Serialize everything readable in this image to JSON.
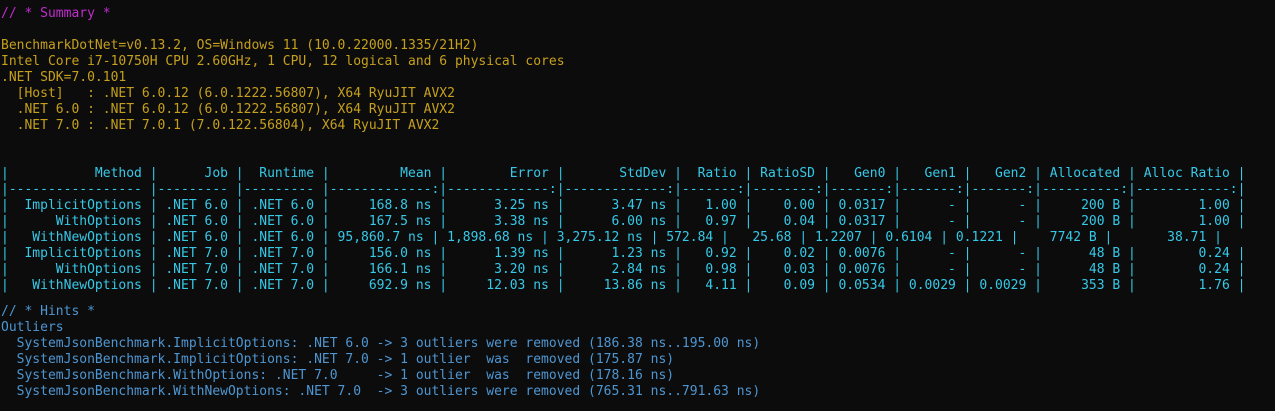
{
  "colors": {
    "background": "#0c0c0c",
    "summary_header": "#c22ccf",
    "env_info": "#c6a01d",
    "table": "#36c9e8",
    "hints": "#4e96d2"
  },
  "summary": {
    "header": "// * Summary *"
  },
  "environment": {
    "lines": [
      "BenchmarkDotNet=v0.13.2, OS=Windows 11 (10.0.22000.1335/21H2)",
      "Intel Core i7-10750H CPU 2.60GHz, 1 CPU, 12 logical and 6 physical cores",
      ".NET SDK=7.0.101",
      "  [Host]   : .NET 6.0.12 (6.0.1222.56807), X64 RyuJIT AVX2",
      "  .NET 6.0 : .NET 6.0.12 (6.0.1222.56807), X64 RyuJIT AVX2",
      "  .NET 7.0 : .NET 7.0.1 (7.0.122.56804), X64 RyuJIT AVX2"
    ]
  },
  "results_table": {
    "header": "|           Method |      Job |  Runtime |         Mean |        Error |       StdDev |  Ratio | RatioSD |   Gen0 |   Gen1 |   Gen2 | Allocated | Alloc Ratio |",
    "separator": "|----------------- |--------- |--------- |-------------:|-------------:|-------------:|-------:|--------:|-------:|-------:|-------:|----------:|------------:|",
    "rows": [
      "|  ImplicitOptions | .NET 6.0 | .NET 6.0 |     168.8 ns |      3.25 ns |      3.47 ns |   1.00 |    0.00 | 0.0317 |      - |      - |     200 B |        1.00 |",
      "|      WithOptions | .NET 6.0 | .NET 6.0 |     167.5 ns |      3.38 ns |      6.00 ns |   0.97 |    0.04 | 0.0317 |      - |      - |     200 B |        1.00 |",
      "|   WithNewOptions | .NET 6.0 | .NET 6.0 | 95,860.7 ns | 1,898.68 ns | 3,275.12 ns | 572.84 |   25.68 | 1.2207 | 0.6104 | 0.1221 |    7742 B |       38.71 |",
      "|  ImplicitOptions | .NET 7.0 | .NET 7.0 |     156.0 ns |      1.39 ns |      1.23 ns |   0.92 |    0.02 | 0.0076 |      - |      - |      48 B |        0.24 |",
      "|      WithOptions | .NET 7.0 | .NET 7.0 |     166.1 ns |      3.20 ns |      2.84 ns |   0.98 |    0.03 | 0.0076 |      - |      - |      48 B |        0.24 |",
      "|   WithNewOptions | .NET 7.0 | .NET 7.0 |     692.9 ns |     12.03 ns |     13.86 ns |   4.11 |    0.09 | 0.0534 | 0.0029 | 0.0029 |     353 B |        1.76 |"
    ]
  },
  "hints": {
    "header": "// * Hints *",
    "section": "Outliers",
    "lines": [
      "  SystemJsonBenchmark.ImplicitOptions: .NET 6.0 -> 3 outliers were removed (186.38 ns..195.00 ns)",
      "  SystemJsonBenchmark.ImplicitOptions: .NET 7.0 -> 1 outlier  was  removed (175.87 ns)",
      "  SystemJsonBenchmark.WithOptions: .NET 7.0     -> 1 outlier  was  removed (178.16 ns)",
      "  SystemJsonBenchmark.WithNewOptions: .NET 7.0  -> 3 outliers were removed (765.31 ns..791.63 ns)"
    ]
  }
}
